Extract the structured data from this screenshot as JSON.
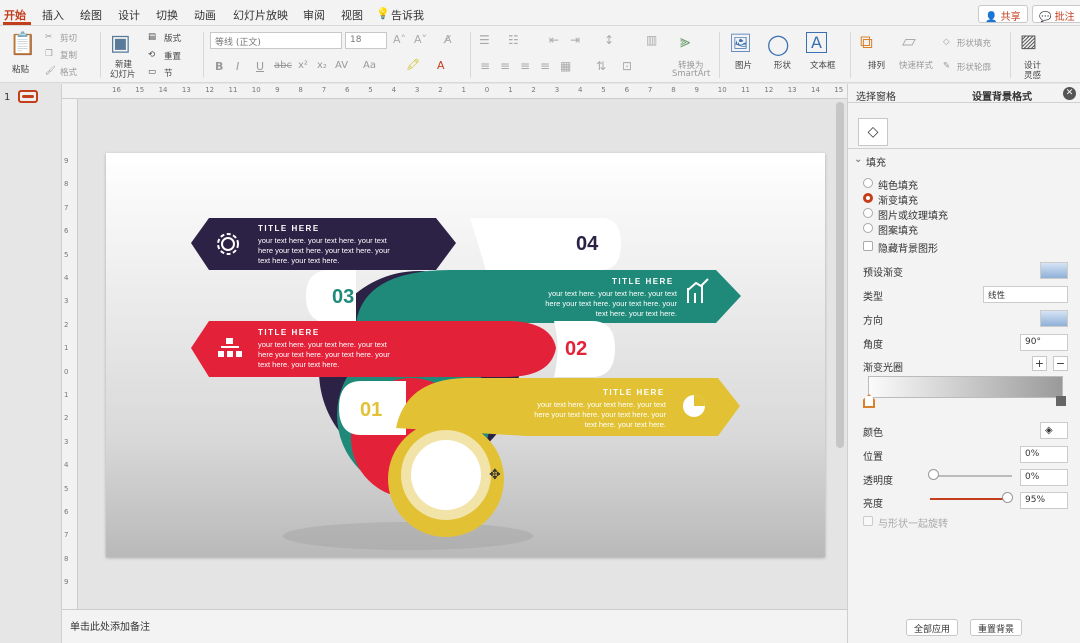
{
  "tabs": [
    "开始",
    "插入",
    "绘图",
    "设计",
    "切换",
    "动画",
    "幻灯片放映",
    "审阅",
    "视图"
  ],
  "tell_me": "告诉我",
  "share_label": "共享",
  "comment_label": "批注",
  "ribbon": {
    "paste": "粘贴",
    "cut": "剪切",
    "copy": "复制",
    "format": "格式",
    "new_slide_1": "新建",
    "new_slide_2": "幻灯片",
    "layout": "版式",
    "reset": "重置",
    "section": "节",
    "font_name": "等线 (正文)",
    "font_size": "18",
    "to_smartart_1": "转换为",
    "to_smartart_2": "SmartArt",
    "picture": "图片",
    "shape": "形状",
    "textbox": "文本框",
    "arrange": "排列",
    "quick_styles": "快速样式",
    "shape_fill": "形状填充",
    "shape_outline": "形状轮廓",
    "designer_1": "设计",
    "designer_2": "灵感"
  },
  "slide_number": "1",
  "ruler_h": [
    "16",
    "15",
    "14",
    "13",
    "12",
    "11",
    "10",
    "9",
    "8",
    "7",
    "6",
    "5",
    "4",
    "3",
    "2",
    "1",
    "0",
    "1",
    "2",
    "3",
    "4",
    "5",
    "6",
    "7",
    "8",
    "9",
    "10",
    "11",
    "12",
    "13",
    "14",
    "15",
    "16"
  ],
  "ruler_v": [
    "9",
    "8",
    "7",
    "6",
    "5",
    "4",
    "3",
    "2",
    "1",
    "0",
    "1",
    "2",
    "3",
    "4",
    "5",
    "6",
    "7",
    "8",
    "9"
  ],
  "notes_placeholder": "单击此处添加备注",
  "panel": {
    "tab_selection": "选择窗格",
    "tab_format": "设置背景格式",
    "section_fill": "填充",
    "options": [
      "纯色填充",
      "渐变填充",
      "图片或纹理填充",
      "图案填充"
    ],
    "hide_bg": "隐藏背景图形",
    "preset": "预设渐变",
    "type": "类型",
    "type_value": "线性",
    "direction": "方向",
    "angle": "角度",
    "angle_value": "90°",
    "stops": "渐变光圈",
    "color": "颜色",
    "position": "位置",
    "position_value": "0%",
    "transparency": "透明度",
    "transparency_value": "0%",
    "brightness": "亮度",
    "brightness_value": "95%",
    "rotate": "与形状一起旋转",
    "apply_all": "全部应用",
    "reset_bg": "重置背景"
  },
  "slide": {
    "items": [
      {
        "num": "04",
        "title": "TITLE HERE",
        "lines": [
          "your text here. your text here. your text",
          "here your text here. your text here. your",
          "text here. your text here."
        ],
        "color": "#2b2246"
      },
      {
        "num": "03",
        "title": "TITLE HERE",
        "lines": [
          "your text here. your text here. your text",
          "here your text here. your text here. your",
          "text here. your text here."
        ],
        "color": "#1f8a7a"
      },
      {
        "num": "02",
        "title": "TITLE HERE",
        "lines": [
          "your text here. your text here. your text",
          "here your text here. your text here. your",
          "text here. your text here."
        ],
        "color": "#e3223a"
      },
      {
        "num": "01",
        "title": "TITLE HERE",
        "lines": [
          "your text here. your text here. your text",
          "here your text here. your text here. your",
          "text here. your text here."
        ],
        "color": "#e2c234"
      }
    ]
  },
  "colors": {
    "accent": "#c43e1c"
  }
}
